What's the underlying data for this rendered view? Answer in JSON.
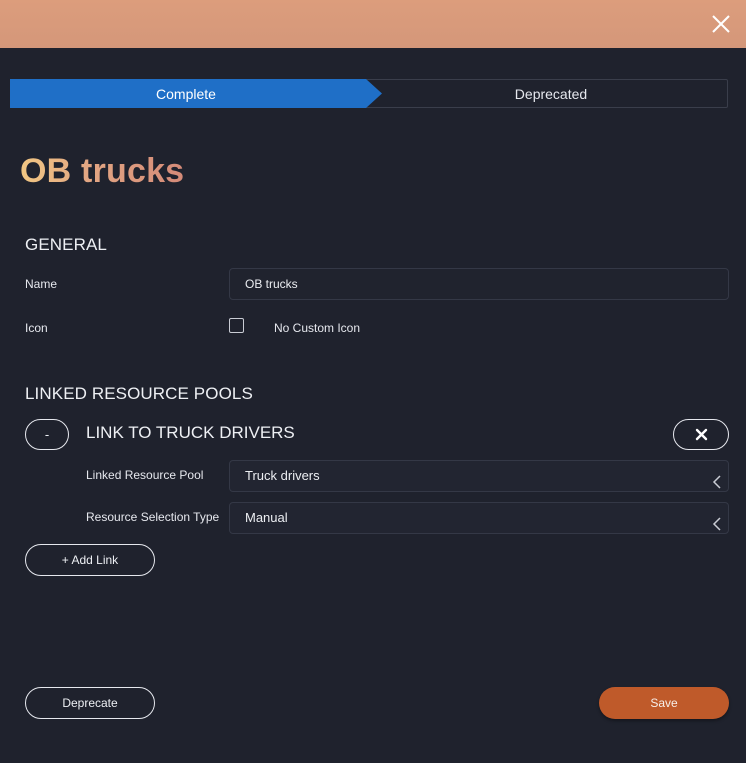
{
  "window": {
    "close_icon": "close-icon"
  },
  "steps": {
    "complete_label": "Complete",
    "deprecated_label": "Deprecated",
    "active_color": "#1f6fc7"
  },
  "title": "OB trucks",
  "general": {
    "heading": "GENERAL",
    "name_label": "Name",
    "name_value": "OB trucks",
    "icon_label": "Icon",
    "custom_icon_checkbox_label": "No Custom Icon",
    "custom_icon_checked": false
  },
  "linked_pools": {
    "heading": "LINKED RESOURCE POOLS",
    "links": [
      {
        "collapse_label": "-",
        "title": "LINK TO TRUCK DRIVERS",
        "pool_label": "Linked Resource Pool",
        "pool_value": "Truck drivers",
        "selection_label": "Resource Selection Type",
        "selection_value": "Manual"
      }
    ],
    "add_link_label": "+ Add Link"
  },
  "footer": {
    "deprecate_label": "Deprecate",
    "save_label": "Save",
    "save_color": "#bf5a2a"
  }
}
